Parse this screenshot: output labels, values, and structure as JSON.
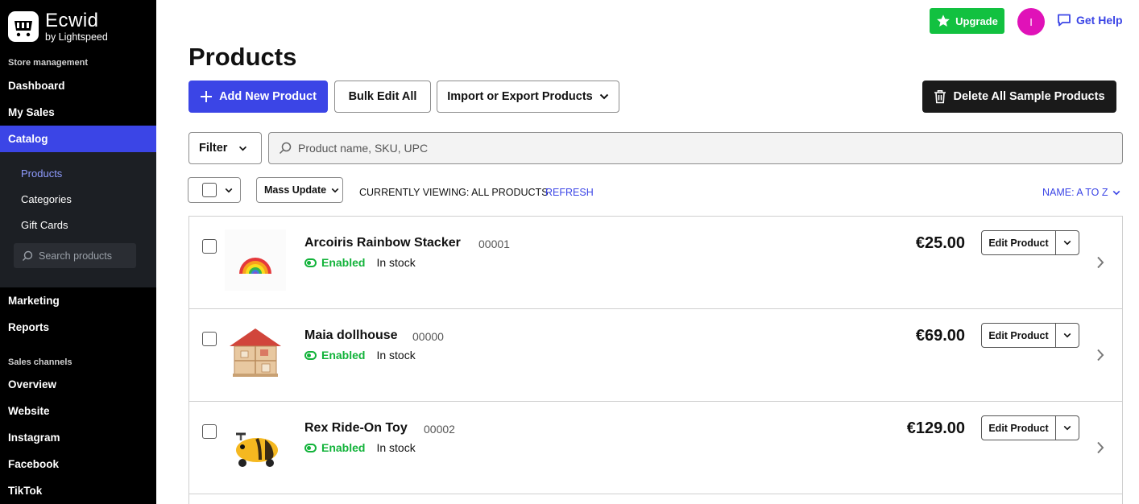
{
  "brand": {
    "name": "Ecwid",
    "sub": "by Lightspeed"
  },
  "sidebar": {
    "section_store": "Store management",
    "items_top": [
      {
        "label": "Dashboard"
      },
      {
        "label": "My Sales"
      },
      {
        "label": "Catalog",
        "active": true
      }
    ],
    "catalog_sub": [
      {
        "label": "Products",
        "active": true
      },
      {
        "label": "Categories"
      },
      {
        "label": "Gift Cards"
      }
    ],
    "search_placeholder": "Search products",
    "items_mid": [
      {
        "label": "Marketing"
      },
      {
        "label": "Reports"
      }
    ],
    "section_channels": "Sales channels",
    "channels": [
      {
        "label": "Overview"
      },
      {
        "label": "Website"
      },
      {
        "label": "Instagram"
      },
      {
        "label": "Facebook"
      },
      {
        "label": "TikTok"
      }
    ]
  },
  "header": {
    "upgrade_label": "Upgrade",
    "avatar_initial": "I",
    "help_label": "Get Help"
  },
  "page": {
    "title": "Products",
    "add_label": "Add New Product",
    "bulk_label": "Bulk Edit All",
    "import_label": "Import or Export Products",
    "delete_label": "Delete All Sample Products",
    "filter_label": "Filter",
    "search_placeholder": "Product name, SKU, UPC",
    "mass_update_label": "Mass Update",
    "viewing_text": "CURRENTLY VIEWING: ALL PRODUCTS",
    "refresh_label": "REFRESH",
    "sort_label": "NAME: A TO Z"
  },
  "products": [
    {
      "name": "Arcoiris Rainbow Stacker",
      "sku": "00001",
      "status": "Enabled",
      "stock": "In stock",
      "price": "€25.00",
      "edit_label": "Edit Product",
      "image_icon": "rainbow-stacker-image"
    },
    {
      "name": "Maia dollhouse",
      "sku": "00000",
      "status": "Enabled",
      "stock": "In stock",
      "price": "€69.00",
      "edit_label": "Edit Product",
      "image_icon": "dollhouse-image"
    },
    {
      "name": "Rex Ride-On Toy",
      "sku": "00002",
      "status": "Enabled",
      "stock": "In stock",
      "price": "€129.00",
      "edit_label": "Edit Product",
      "image_icon": "ride-on-toy-image"
    }
  ],
  "colors": {
    "accent": "#3b45e6",
    "success": "#12c140",
    "sidebar_bg": "#000000",
    "avatar": "#e012b8"
  }
}
